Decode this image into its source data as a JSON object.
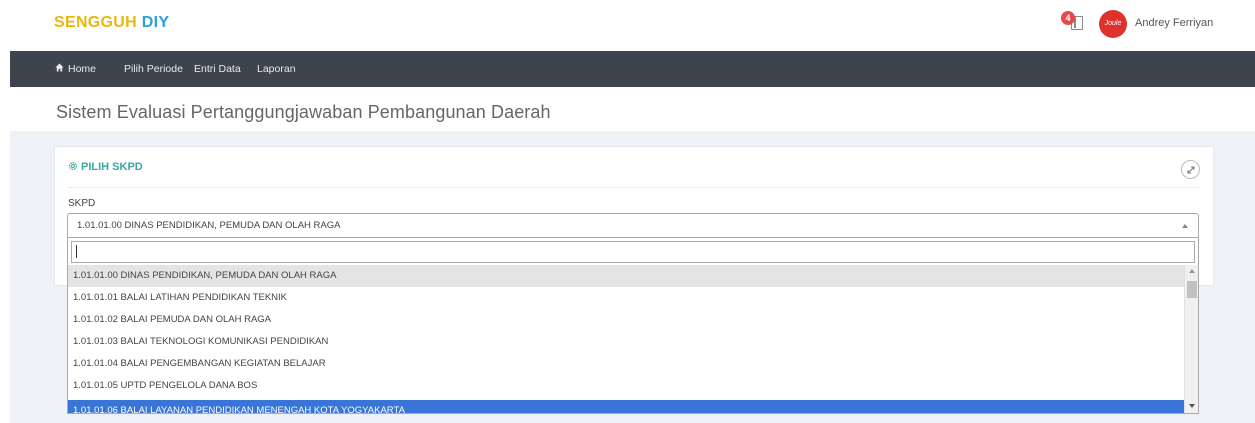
{
  "header": {
    "brand_part1": "SENGGUH",
    "brand_part2": "DIY",
    "notification_count": "4",
    "avatar_text": "Joule",
    "username": "Andrey Ferriyan"
  },
  "nav": {
    "items": [
      {
        "label": "Home",
        "icon": "home-icon"
      },
      {
        "label": "Pilih Periode"
      },
      {
        "label": "Entri Data"
      },
      {
        "label": "Laporan"
      }
    ]
  },
  "page": {
    "title": "Sistem Evaluasi Pertanggungjawaban Pembangunan Daerah"
  },
  "panel": {
    "title": "PILIH SKPD",
    "title_icon": "gear-icon",
    "expand_icon": "expand-icon",
    "field_label": "SKPD",
    "selected_value": "1.01.01.00 DINAS PENDIDIKAN, PEMUDA DAN OLAH RAGA",
    "search_value": "",
    "options": [
      "1.01.01.00 DINAS PENDIDIKAN, PEMUDA DAN OLAH RAGA",
      "1.01.01.01 BALAI LATIHAN PENDIDIKAN TEKNIK",
      "1.01.01.02 BALAI PEMUDA DAN OLAH RAGA",
      "1.01.01.03 BALAI TEKNOLOGI KOMUNIKASI PENDIDIKAN",
      "1.01.01.04 BALAI PENGEMBANGAN KEGIATAN BELAJAR",
      "1.01.01.05 UPTD PENGELOLA DANA BOS",
      "1.01.01.06 BALAI LAYANAN PENDIDIKAN MENENGAH KOTA YOGYAKARTA"
    ],
    "highlighted_index": 0,
    "hovered_index": 6
  },
  "colors": {
    "brand_yellow": "#e8b90a",
    "brand_blue": "#29a3d6",
    "nav_bg": "#3d444e",
    "panel_title": "#3aa7a1",
    "option_hover": "#3875d7",
    "badge": "#e34a4a"
  }
}
